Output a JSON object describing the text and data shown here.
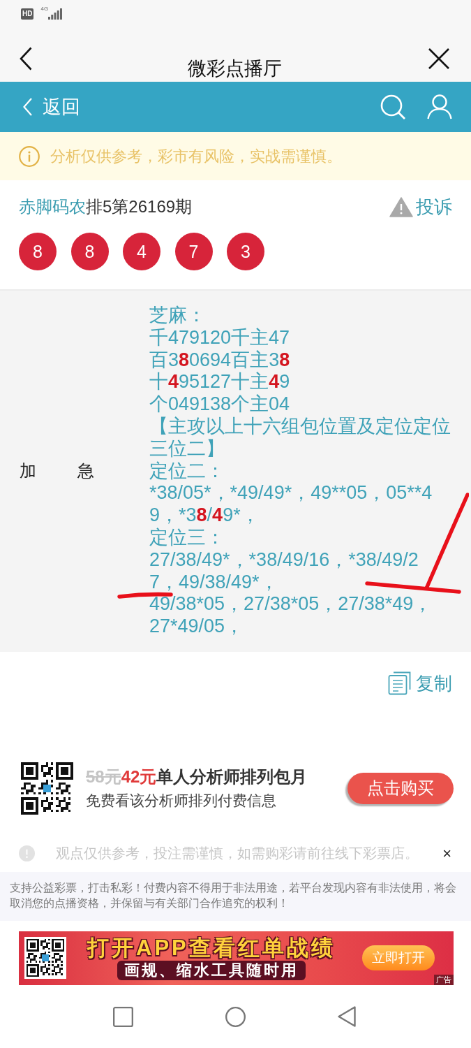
{
  "status_bar": {
    "badge": "HD",
    "network": "4G"
  },
  "title_bar": {
    "title": "微彩点播厅"
  },
  "nav_bar": {
    "back_label": "返回"
  },
  "warning": {
    "text": "分析仅供参考，彩市有风险，实战需谨慎。"
  },
  "post": {
    "author": "赤脚码农",
    "title": "排5第26169期",
    "report_label": "投诉",
    "numbers": [
      "8",
      "8",
      "4",
      "7",
      "3"
    ],
    "category": "加 急",
    "lines": [
      {
        "segments": [
          {
            "text": "芝麻：",
            "highlighted": false
          }
        ]
      },
      {
        "segments": [
          {
            "text": "千479120千主47",
            "highlighted": false
          }
        ]
      },
      {
        "segments": [
          {
            "text": "百3",
            "highlighted": false
          },
          {
            "text": "8",
            "highlighted": true
          },
          {
            "text": "0694百主3",
            "highlighted": false
          },
          {
            "text": "8",
            "highlighted": true
          }
        ]
      },
      {
        "segments": [
          {
            "text": "十",
            "highlighted": false
          },
          {
            "text": "4",
            "highlighted": true
          },
          {
            "text": "95127十主",
            "highlighted": false
          },
          {
            "text": "4",
            "highlighted": true
          },
          {
            "text": "9",
            "highlighted": false
          }
        ]
      },
      {
        "segments": [
          {
            "text": "个049138个主04",
            "highlighted": false
          }
        ]
      },
      {
        "segments": [
          {
            "text": "【主攻以上十六组包位置及定位定位",
            "highlighted": false
          }
        ]
      },
      {
        "segments": [
          {
            "text": "三位二】",
            "highlighted": false
          }
        ]
      },
      {
        "segments": [
          {
            "text": "定位二：",
            "highlighted": false
          }
        ]
      },
      {
        "segments": [
          {
            "text": "*38/05*，*49/49*，49**05，05**4",
            "highlighted": false
          }
        ]
      },
      {
        "segments": [
          {
            "text": "9，*3",
            "highlighted": false
          },
          {
            "text": "8",
            "highlighted": true
          },
          {
            "text": "/",
            "highlighted": false
          },
          {
            "text": "4",
            "highlighted": true
          },
          {
            "text": "9*，",
            "highlighted": false
          }
        ]
      },
      {
        "segments": [
          {
            "text": "定位三：",
            "highlighted": false
          }
        ]
      },
      {
        "segments": [
          {
            "text": "27/38/49*，*38/49/16，*38/49/2",
            "highlighted": false
          }
        ]
      },
      {
        "segments": [
          {
            "text": "7，49/38/49*，",
            "highlighted": false
          }
        ]
      },
      {
        "segments": [
          {
            "text": "49/38*05，27/38*05，27/38*49，",
            "highlighted": false
          }
        ]
      },
      {
        "segments": [
          {
            "text": "27*49/05，",
            "highlighted": false
          }
        ]
      }
    ],
    "copy_label": "复制"
  },
  "pen_marks": {
    "underline": true,
    "tick": true
  },
  "offer": {
    "old_price": "58元",
    "price": "42元",
    "title": "单人分析师排列包月",
    "subtitle": "免费看该分析师排列付费信息",
    "button": "点击购买"
  },
  "notice": {
    "text": "观点仅供参考，投注需谨慎，如需购彩请前往线下彩票店。",
    "close": "×"
  },
  "disclaimer": "支持公益彩票，打击私彩！付费内容不得用于非法用途，若平台发现内容有非法使用，将会取消您的点播资格，并保留与有关部门合作追究的权利！",
  "ad": {
    "headline": "打开APP查看红单战绩",
    "subline": "画规、缩水工具随时用",
    "button": "立即打开",
    "tag": "广告"
  }
}
